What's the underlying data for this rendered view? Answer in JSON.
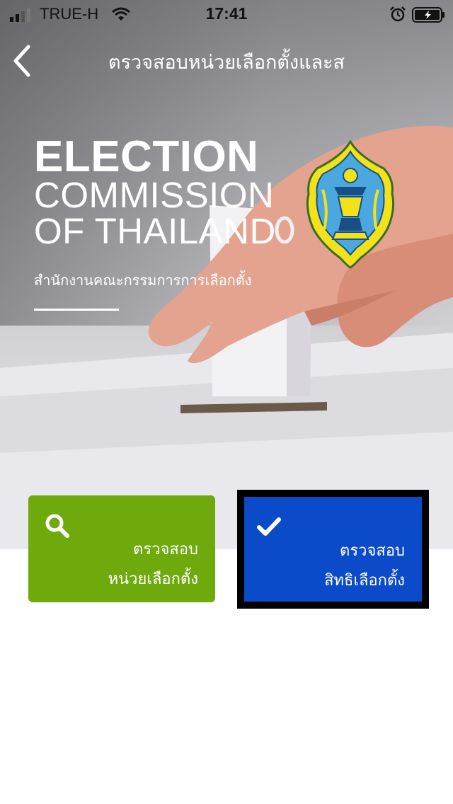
{
  "status_bar": {
    "carrier": "TRUE-H",
    "time": "17:41",
    "icons": [
      "signal-icon",
      "wifi-icon",
      "alarm-icon",
      "battery-icon"
    ]
  },
  "nav": {
    "back_icon": "chevron-left-icon",
    "title": "ตรวจสอบหน่วยเลือกตั้งและส"
  },
  "hero": {
    "brand_line1": "ELECTION",
    "brand_line2": "COMMISSION",
    "brand_line3": "OF THAILAND",
    "brand_thai": "สำนักงานคณะกรรมการการเลือกตั้ง",
    "logo_icon": "ect-emblem-icon"
  },
  "actions": [
    {
      "icon": "search-icon",
      "line1": "ตรวจสอบ",
      "line2": "หน่วยเลือกตั้ง",
      "color": "#6eaa0c"
    },
    {
      "icon": "checkmark-icon",
      "line1": "ตรวจสอบ",
      "line2": "สิทธิเลือกตั้ง",
      "color": "#0b4ac9",
      "selected": true
    }
  ],
  "colors": {
    "green_button": "#6eaa0c",
    "blue_button": "#0b4ac9",
    "selection_frame": "#000000"
  }
}
